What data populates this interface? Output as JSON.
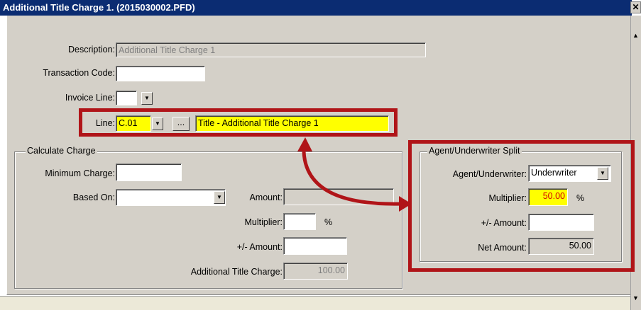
{
  "window": {
    "title": "Additional Title Charge 1. (2015030002.PFD)",
    "close_glyph": "✕"
  },
  "form": {
    "description_label": "Description:",
    "description_value": "Additional Title Charge 1",
    "transaction_code_label": "Transaction Code:",
    "transaction_code_value": "",
    "invoice_line_label": "Invoice Line:",
    "invoice_line_value": "",
    "line_label": "Line:",
    "line_value": "C.01",
    "line_browse_label": "...",
    "line_description": "Title - Additional Title Charge 1"
  },
  "calculate_charge": {
    "group_title": "Calculate Charge",
    "minimum_charge_label": "Minimum Charge:",
    "minimum_charge_value": "",
    "based_on_label": "Based On:",
    "based_on_value": "",
    "amount_label": "Amount:",
    "amount_value": "",
    "multiplier_label": "Multiplier:",
    "multiplier_value": "",
    "percent_sign": "%",
    "plus_minus_amount_label": "+/- Amount:",
    "plus_minus_amount_value": "",
    "additional_title_charge_label": "Additional Title Charge:",
    "additional_title_charge_value": "100.00"
  },
  "agent_split": {
    "group_title": "Agent/Underwriter Split",
    "agent_underwriter_label": "Agent/Underwriter:",
    "agent_underwriter_value": "Underwriter",
    "multiplier_label": "Multiplier:",
    "multiplier_value": "50.00",
    "percent_sign": "%",
    "plus_minus_amount_label": "+/- Amount:",
    "plus_minus_amount_value": "",
    "net_amount_label": "Net Amount:",
    "net_amount_value": "50.00"
  },
  "colors": {
    "titlebar": "#0b2c72",
    "highlight_yellow": "#ffff00",
    "annotation_red": "#b01418",
    "dialog_face": "#d4d0c8"
  }
}
